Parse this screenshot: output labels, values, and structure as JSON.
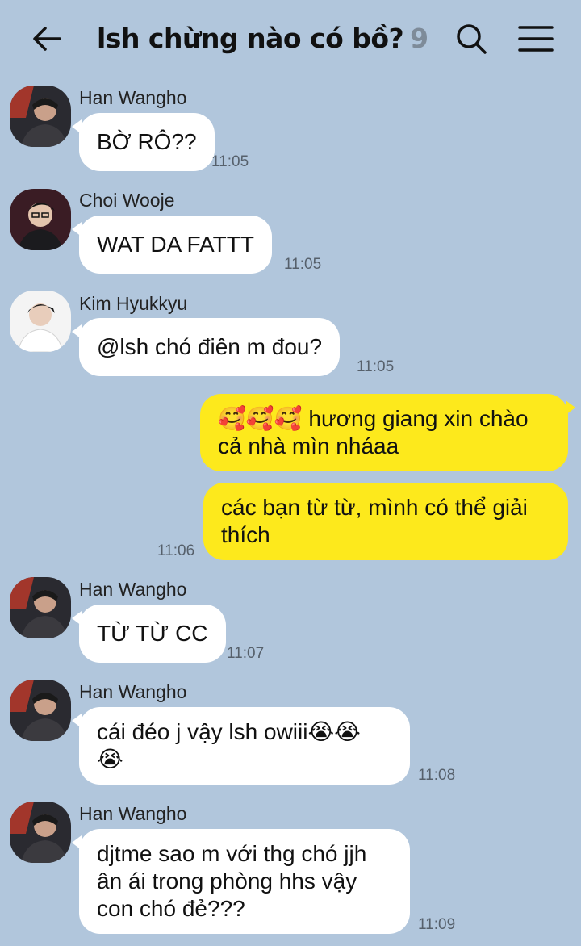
{
  "header": {
    "title": "lsh chừng nào có bồ?",
    "member_count": "9",
    "back_icon": "arrow-left-icon",
    "search_icon": "search-icon",
    "menu_icon": "hamburger-menu-icon"
  },
  "colors": {
    "background": "#b1c6dc",
    "incoming_bubble": "#ffffff",
    "outgoing_bubble": "#fde91c"
  },
  "messages": [
    {
      "sender": "Han Wangho",
      "text": "BỜ RÔ??",
      "time": "11:05"
    },
    {
      "sender": "Choi Wooje",
      "text": "WAT DA FATTT",
      "time": "11:05"
    },
    {
      "sender": "Kim Hyukkyu",
      "text": "@lsh chó điên m đou?",
      "time": "11:05"
    },
    {
      "sender": "",
      "emoji": "🥰🥰🥰",
      "line1": "hương giang xin chào",
      "line2": "cả nhà mìn nháaa",
      "time": ""
    },
    {
      "sender": "",
      "line1": "các bạn từ từ, mình có thể giải",
      "line2": "thích",
      "time": "11:06"
    },
    {
      "sender": "Han Wangho",
      "text": "TỪ TỪ CC",
      "time": "11:07"
    },
    {
      "sender": "Han Wangho",
      "line1": "cái đéo j vậy lsh owiii",
      "emoji1": "😭😭",
      "emoji2": "😭",
      "time": "11:08"
    },
    {
      "sender": "Han Wangho",
      "line1": "djtme sao m với thg chó jjh",
      "line2": "ân ái trong phòng hhs vậy",
      "line3": "con chó đẻ???",
      "time": "11:09"
    }
  ]
}
